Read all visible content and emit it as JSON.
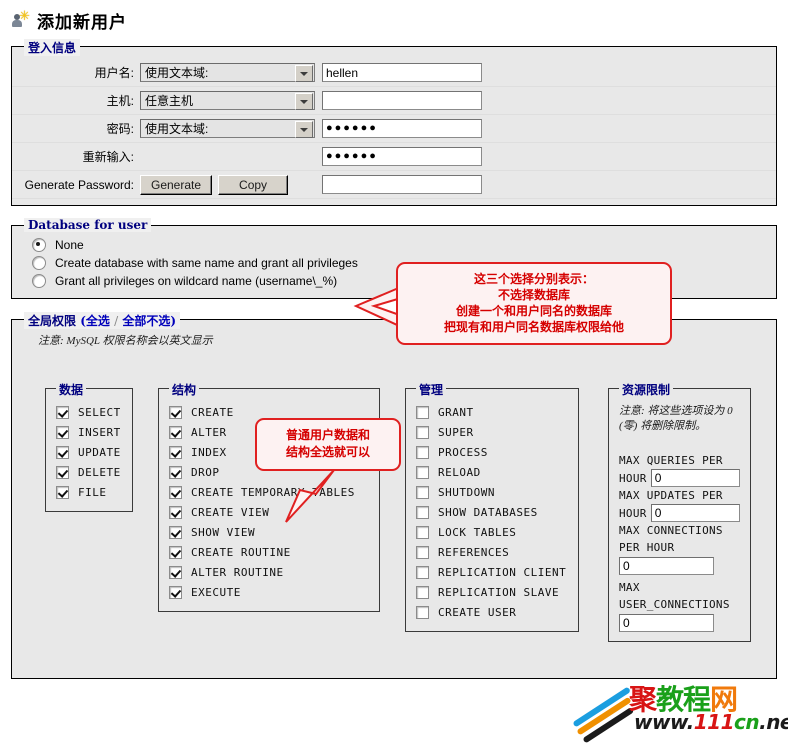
{
  "page": {
    "title": "添加新用户",
    "title_icon": "add-user-icon"
  },
  "login_panel": {
    "legend": "登入信息",
    "rows": [
      {
        "label": "用户名:",
        "select_value": "使用文本域:",
        "has_select": true,
        "input_value": "hellen",
        "is_password": false
      },
      {
        "label": "主机:",
        "select_value": "任意主机",
        "has_select": true,
        "input_value": "",
        "is_password": false
      },
      {
        "label": "密码:",
        "select_value": "使用文本域:",
        "has_select": true,
        "input_value": "●●●●●●",
        "is_password": true
      },
      {
        "label": "重新输入:",
        "select_value": "",
        "has_select": false,
        "input_value": "●●●●●●",
        "is_password": true
      }
    ],
    "generate_row": {
      "label": "Generate Password:",
      "generate_button": "Generate",
      "copy_button": "Copy",
      "output_value": ""
    }
  },
  "db_panel": {
    "legend": "Database for user",
    "options": [
      {
        "label": "None",
        "checked": true
      },
      {
        "label": "Create database with same name and grant all privileges",
        "checked": false
      },
      {
        "label": "Grant all privileges on wildcard name (username\\_%)",
        "checked": false
      }
    ]
  },
  "priv_panel": {
    "legend_main": "全局权限",
    "legend_select_all": "(全选",
    "legend_sep": "/",
    "legend_deselect_all": "全部不选)",
    "note": "注意: MySQL 权限名称会以英文显示",
    "boxes": [
      {
        "legend": "数据",
        "items": [
          {
            "label": "SELECT",
            "checked": true
          },
          {
            "label": "INSERT",
            "checked": true
          },
          {
            "label": "UPDATE",
            "checked": true
          },
          {
            "label": "DELETE",
            "checked": true
          },
          {
            "label": "FILE",
            "checked": true
          }
        ]
      },
      {
        "legend": "结构",
        "items": [
          {
            "label": "CREATE",
            "checked": true
          },
          {
            "label": "ALTER",
            "checked": true
          },
          {
            "label": "INDEX",
            "checked": true
          },
          {
            "label": "DROP",
            "checked": true
          },
          {
            "label": "CREATE TEMPORARY TABLES",
            "checked": true
          },
          {
            "label": "CREATE VIEW",
            "checked": true
          },
          {
            "label": "SHOW VIEW",
            "checked": true
          },
          {
            "label": "CREATE ROUTINE",
            "checked": true
          },
          {
            "label": "ALTER ROUTINE",
            "checked": true
          },
          {
            "label": "EXECUTE",
            "checked": true
          }
        ]
      },
      {
        "legend": "管理",
        "items": [
          {
            "label": "GRANT",
            "checked": false
          },
          {
            "label": "SUPER",
            "checked": false
          },
          {
            "label": "PROCESS",
            "checked": false
          },
          {
            "label": "RELOAD",
            "checked": false
          },
          {
            "label": "SHUTDOWN",
            "checked": false
          },
          {
            "label": "SHOW DATABASES",
            "checked": false
          },
          {
            "label": "LOCK TABLES",
            "checked": false
          },
          {
            "label": "REFERENCES",
            "checked": false
          },
          {
            "label": "REPLICATION CLIENT",
            "checked": false
          },
          {
            "label": "REPLICATION SLAVE",
            "checked": false
          },
          {
            "label": "CREATE USER",
            "checked": false
          }
        ]
      }
    ],
    "resource_box": {
      "legend": "资源限制",
      "note": "注意: 将这些选项设为 0 (零) 将删除限制。",
      "fields": [
        {
          "label_line1": "MAX QUERIES PER",
          "label_line2": "HOUR",
          "value": "0",
          "inline": true
        },
        {
          "label_line1": "MAX UPDATES PER",
          "label_line2": "HOUR",
          "value": "0",
          "inline": true
        },
        {
          "label_line1": "MAX CONNECTIONS",
          "label_line2": "PER HOUR",
          "value": "0",
          "inline": false
        },
        {
          "label_line1": "MAX",
          "label_line2": "USER_CONNECTIONS",
          "value": "0",
          "inline": false
        }
      ]
    }
  },
  "callouts": {
    "db_callout": {
      "line1": "这三个选择分别表示：",
      "line2": "不选择数据库",
      "line3": "创建一个和用户同名的数据库",
      "line4": "把现有和用户同名数据库权限给他"
    },
    "priv_callout": {
      "line1": "普通用户数据和",
      "line2": "结构全选就可以"
    }
  },
  "watermark": {
    "name_part1": "聚",
    "name_part2": "教程",
    "name_part3": "网",
    "url_part1": "www.",
    "url_part2": "111",
    "url_part3": "cn",
    "url_part4": ".net"
  },
  "colors": {
    "legend_blue": "#00007f",
    "callout_red": "#d50000",
    "panel_bg": "#e8e8e8"
  }
}
